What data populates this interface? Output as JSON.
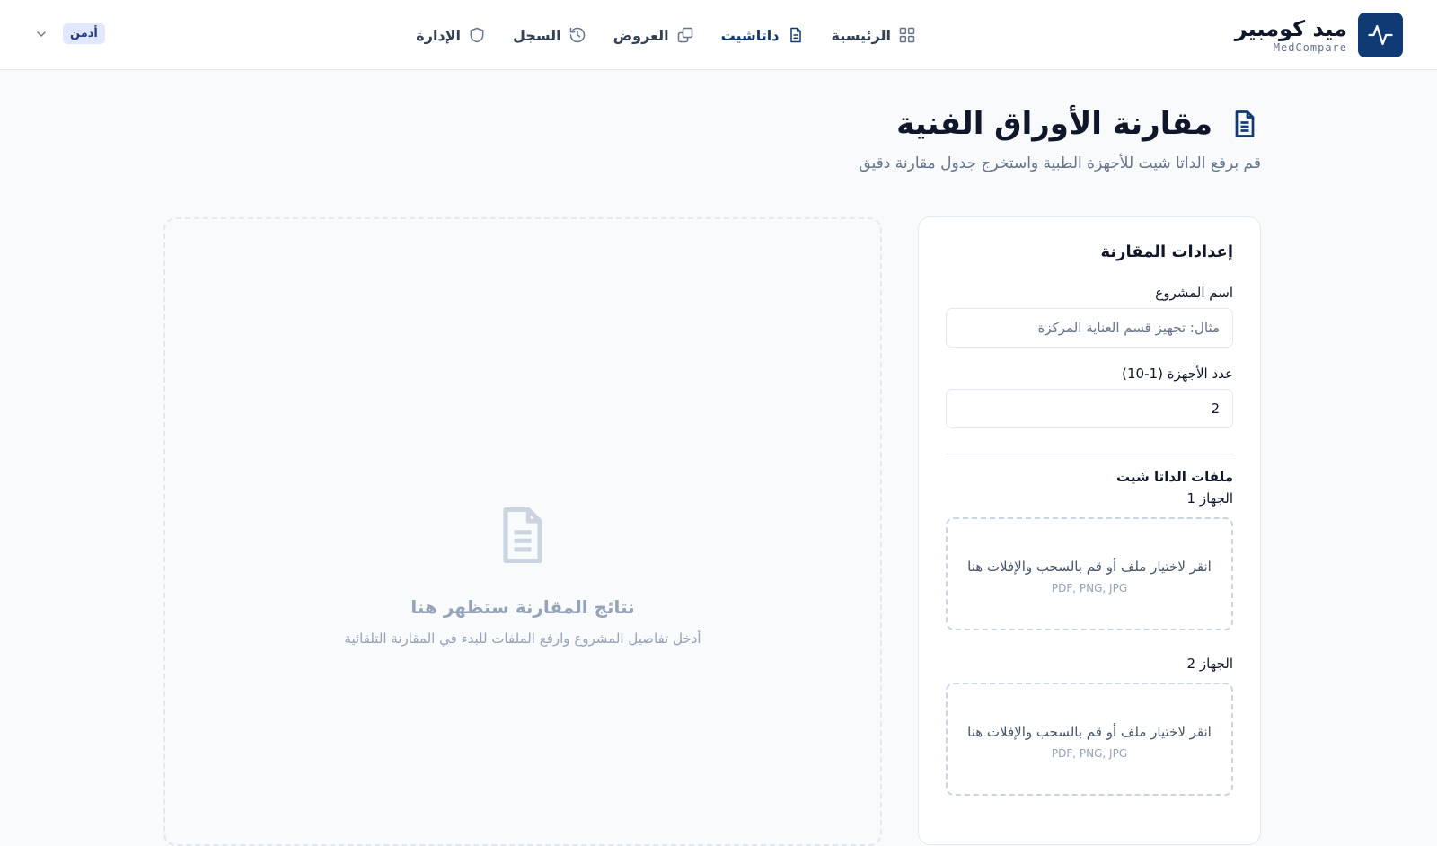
{
  "brand": {
    "name": "ميد كومبير",
    "subtitle": "MedCompare"
  },
  "nav": [
    {
      "label": "الرئيسية",
      "icon": "grid-icon"
    },
    {
      "label": "داتاشيت",
      "icon": "document-icon",
      "active": true
    },
    {
      "label": "العروض",
      "icon": "copy-icon"
    },
    {
      "label": "السجل",
      "icon": "history-icon"
    },
    {
      "label": "الإدارة",
      "icon": "shield-icon"
    }
  ],
  "user": {
    "role": "أدمن"
  },
  "page": {
    "title": "مقارنة الأوراق الفنية",
    "subtitle": "قم برفع الداتا شيت للأجهزة الطبية واستخرج جدول مقارنة دقيق"
  },
  "settings": {
    "title": "إعدادات المقارنة",
    "project_label": "اسم المشروع",
    "project_placeholder": "مثال: تجهيز قسم العناية المركزة",
    "count_label": "عدد الأجهزة (1-10)",
    "count_value": "2",
    "files_label": "ملفات الداتا شيت",
    "devices": [
      {
        "label": "الجهاز 1",
        "drop_text": "انقر لاختيار ملف أو قم بالسحب والإفلات هنا",
        "types": "PDF, PNG, JPG"
      },
      {
        "label": "الجهاز 2",
        "drop_text": "انقر لاختيار ملف أو قم بالسحب والإفلات هنا",
        "types": "PDF, PNG, JPG"
      }
    ]
  },
  "results": {
    "empty_title": "نتائج المقارنة ستظهر هنا",
    "empty_subtitle": "أدخل تفاصيل المشروع وارفع الملفات للبدء في المقارنة التلقائية"
  },
  "colors": {
    "brand": "#0f3a73",
    "muted": "#94a3b8",
    "border": "#e2e8f0"
  }
}
